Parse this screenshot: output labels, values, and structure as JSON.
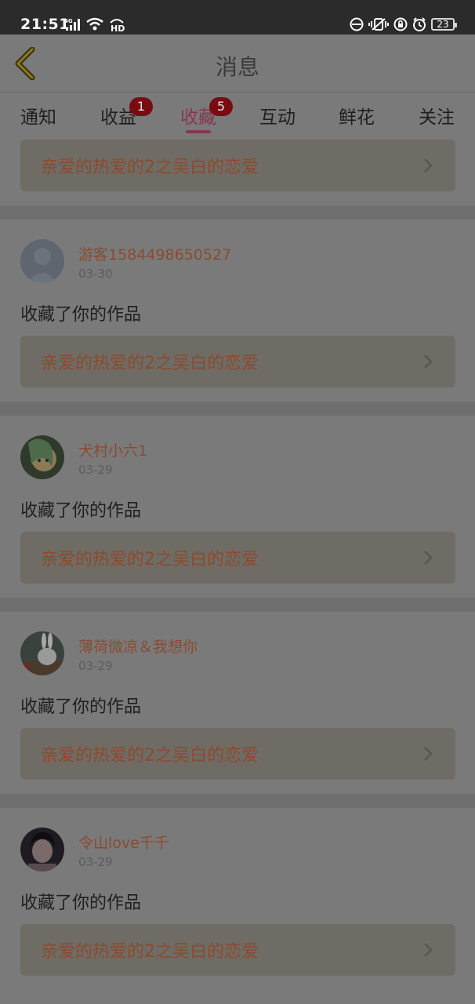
{
  "status_bar": {
    "time": "21:51",
    "network_label": "4G",
    "hd_label": "HD",
    "battery": "23",
    "icons": [
      "signal-icon",
      "wifi-icon",
      "hd-call-icon",
      "mute-icon",
      "vibrate-icon",
      "lock-icon",
      "alarm-icon",
      "battery-icon"
    ]
  },
  "header": {
    "title": "消息",
    "back_icon": "back-chevron-icon"
  },
  "tabs": [
    {
      "label": "通知",
      "badge": ""
    },
    {
      "label": "收益",
      "badge": "1"
    },
    {
      "label": "收藏",
      "badge": "5",
      "active": true
    },
    {
      "label": "互动",
      "badge": ""
    },
    {
      "label": "鲜花",
      "badge": ""
    },
    {
      "label": "关注",
      "badge": ""
    }
  ],
  "items": [
    {
      "work_title": "亲爱的热爱的2之吴白的恋爱"
    },
    {
      "user": "游客1584498650527",
      "date": "03-30",
      "action": "收藏了你的作品",
      "work_title": "亲爱的热爱的2之吴白的恋爱"
    },
    {
      "user": "犬村小六1",
      "date": "03-29",
      "action": "收藏了你的作品",
      "work_title": "亲爱的热爱的2之吴白的恋爱"
    },
    {
      "user": "薄荷微凉＆我想你",
      "date": "03-29",
      "action": "收藏了你的作品",
      "work_title": "亲爱的热爱的2之吴白的恋爱"
    },
    {
      "user": "令山love千千",
      "date": "03-29",
      "action": "收藏了你的作品",
      "work_title": "亲爱的热爱的2之吴白的恋爱"
    }
  ],
  "colors": {
    "accent": "#8a3450",
    "badge": "#7a0b12",
    "link_text": "#8c4a2e"
  }
}
